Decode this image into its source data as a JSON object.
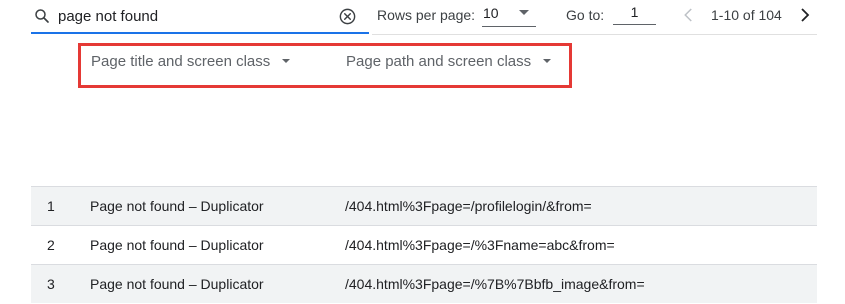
{
  "search": {
    "value": "page not found",
    "placeholder": ""
  },
  "pagination": {
    "rows_per_page_label": "Rows per page:",
    "rows_per_page_value": "10",
    "goto_label": "Go to:",
    "goto_value": "1",
    "range_text": "1-10 of 104"
  },
  "dimensions": [
    {
      "label": "Page title and screen class"
    },
    {
      "label": "Page path and screen class"
    }
  ],
  "rows": [
    {
      "index": "1",
      "title": "Page not found – Duplicator",
      "path": "/404.html%3Fpage=/profilelogin/&from="
    },
    {
      "index": "2",
      "title": "Page not found – Duplicator",
      "path": "/404.html%3Fpage=/%3Fname=abc&from="
    },
    {
      "index": "3",
      "title": "Page not found – Duplicator",
      "path": "/404.html%3Fpage=/%7B%7Bbfb_image&from="
    }
  ],
  "colors": {
    "accent": "#1a73e8",
    "highlight": "#e53935",
    "row_shade": "#f1f3f4"
  },
  "icons": [
    "search-icon",
    "clear-icon",
    "chevron-left-icon",
    "chevron-right-icon",
    "caret-down-icon"
  ]
}
